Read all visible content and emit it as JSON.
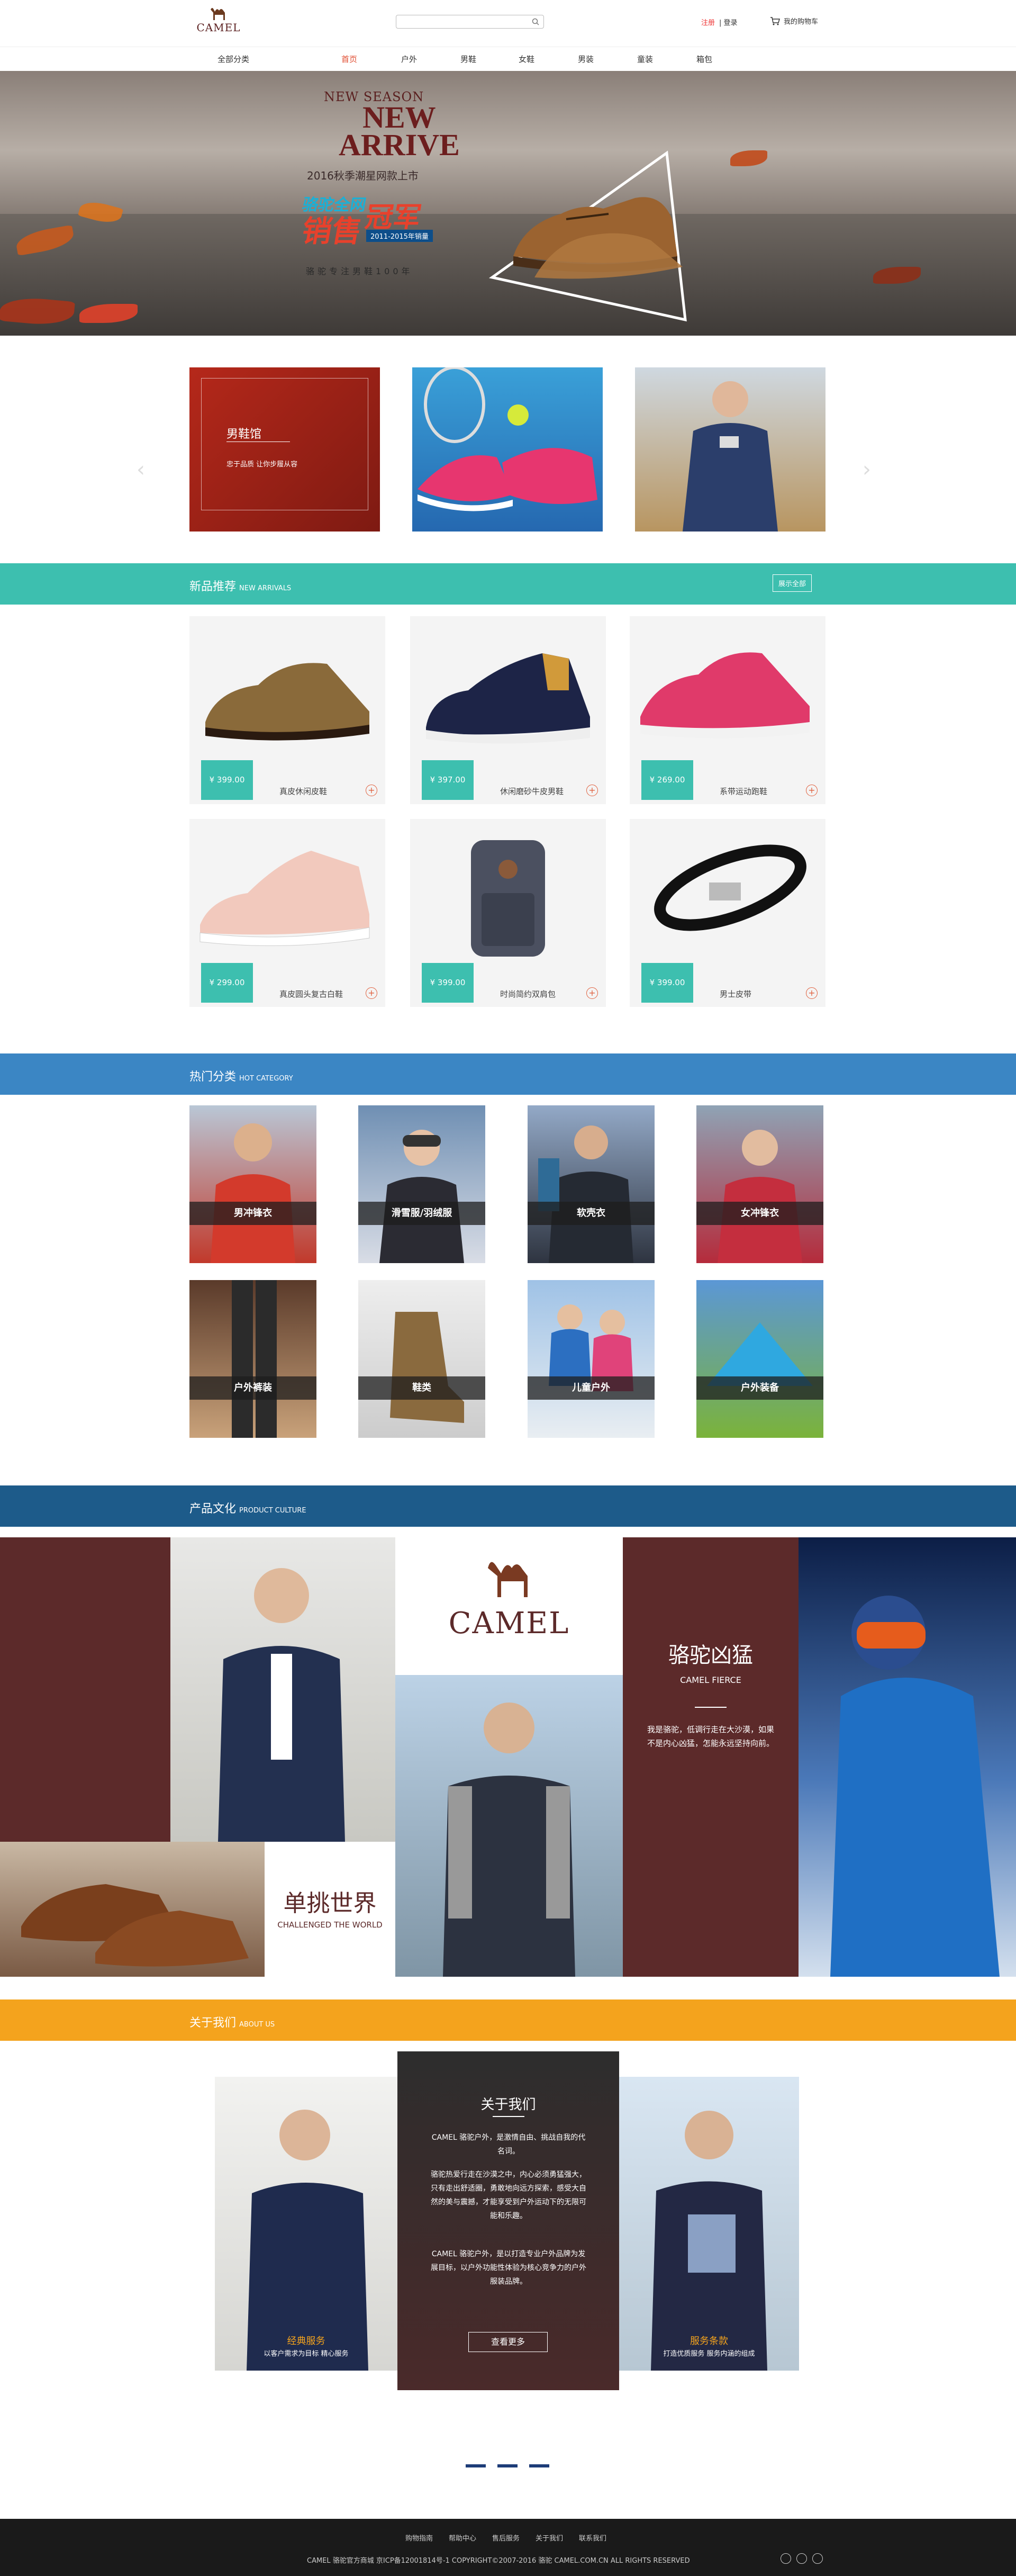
{
  "header": {
    "logo_text": "CAMEL",
    "search_placeholder": "",
    "register": "注册",
    "login": "登录",
    "cart": "我的购物车"
  },
  "nav": {
    "all": "全部分类",
    "items": [
      "首页",
      "户外",
      "男鞋",
      "女鞋",
      "男装",
      "童装",
      "箱包"
    ]
  },
  "hero": {
    "new_season": "NEW SEASON",
    "new": "NEW",
    "arrive": "ARRIVE",
    "subtitle": "2016秋季潮星网款上市",
    "champ1": "骆驼全网",
    "champ2": "销售",
    "champ3": "冠军",
    "years": "2011-2015年销量",
    "tagline": "骆驼专注男鞋100年"
  },
  "category_cards": {
    "men_title": "男鞋馆",
    "men_sub": "忠于品质 让你步履从容"
  },
  "new_arrivals": {
    "title": "新品推荐",
    "en": "NEW ARRIVALS",
    "more": "展示全部",
    "products": [
      {
        "price": "¥ 399.00",
        "name": "真皮休闲皮鞋"
      },
      {
        "price": "¥ 397.00",
        "name": "休闲磨砂牛皮男鞋"
      },
      {
        "price": "¥ 269.00",
        "name": "系带运动跑鞋"
      },
      {
        "price": "¥ 299.00",
        "name": "真皮圆头复古白鞋"
      },
      {
        "price": "¥ 399.00",
        "name": "时尚简约双肩包"
      },
      {
        "price": "¥ 399.00",
        "name": "男士皮带"
      }
    ]
  },
  "hot": {
    "title": "热门分类",
    "en": "HOT CATEGORY",
    "items": [
      "男冲锋衣",
      "滑雪服/羽绒服",
      "软壳衣",
      "女冲锋衣",
      "户外裤装",
      "鞋类",
      "儿童户外",
      "户外装备"
    ]
  },
  "culture": {
    "title": "产品文化",
    "en": "PRODUCT CULTURE",
    "camel": "CAMEL",
    "challenge_zh": "单挑世界",
    "challenge_en": "CHALLENGED THE WORLD",
    "fierce_zh": "骆驼凶猛",
    "fierce_en": "CAMEL FIERCE",
    "fierce_text": "我是骆驼，低调行走在大沙漠，如果不是内心凶猛，怎能永远坚持向前。"
  },
  "about": {
    "title": "关于我们",
    "en": "ABOUT US",
    "heading": "关于我们",
    "p1": "CAMEL 骆驼户外，是激情自由、挑战自我的代名词。",
    "p2": "骆驼热爱行走在沙漠之中，内心必须勇猛强大，只有走出舒适圈，勇敢地向远方探索，感受大自然的美与震撼，才能享受到户外运动下的无限可能和乐趣。",
    "p3": "CAMEL 骆驼户外，是以打造专业户外品牌为发展目标，以户外功能性体验为核心竞争力的户外服装品牌。",
    "more": "查看更多",
    "left_label": "经典服务",
    "left_sub": "以客户需求为目标 精心服务",
    "right_label": "服务条款",
    "right_sub": "打造优质服务 服务内涵的组成"
  },
  "footer": {
    "links": [
      "购物指南",
      "帮助中心",
      "售后服务",
      "关于我们",
      "联系我们"
    ],
    "copyright": "CAMEL 骆驼官方商城 京ICP备12001814号-1  COPYRIGHT©2007-2016 骆驼 CAMEL.COM.CN ALL RIGHTS RESERVED"
  },
  "colors": {
    "teal": "#3dbfaf",
    "blue": "#3b86c4",
    "navy": "#1d5b8a",
    "orange": "#f4a31d",
    "maroon": "#5c2a2a",
    "red": "#e04b2f"
  }
}
